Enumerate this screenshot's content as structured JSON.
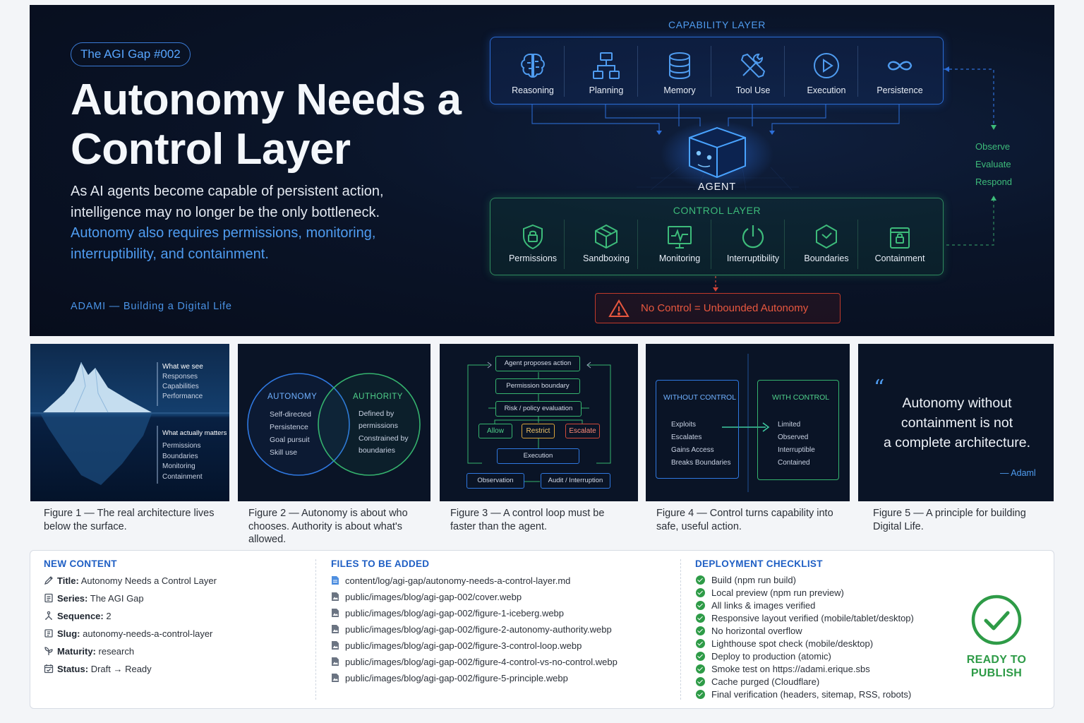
{
  "hero": {
    "series_badge": "The AGI Gap #002",
    "title": "Autonomy Needs a Control Layer",
    "subtitle_plain": "As AI agents become capable of persistent action, intelligence may no longer be the only bottleneck.",
    "subtitle_highlight": "Autonomy also requires permissions, monitoring, interruptibility, and containment.",
    "brand": "ADAMI — Building a Digital Life",
    "capability_layer": {
      "title": "CAPABILITY LAYER",
      "items": [
        {
          "label": "Reasoning",
          "icon": "brain-icon"
        },
        {
          "label": "Planning",
          "icon": "flowchart-icon"
        },
        {
          "label": "Memory",
          "icon": "database-icon"
        },
        {
          "label": "Tool Use",
          "icon": "tools-icon"
        },
        {
          "label": "Execution",
          "icon": "play-icon"
        },
        {
          "label": "Persistence",
          "icon": "infinity-icon"
        }
      ]
    },
    "agent_label": "AGENT",
    "control_layer": {
      "title": "CONTROL LAYER",
      "items": [
        {
          "label": "Permissions",
          "icon": "lock-shield-icon"
        },
        {
          "label": "Sandboxing",
          "icon": "cube-icon"
        },
        {
          "label": "Monitoring",
          "icon": "pulse-monitor-icon"
        },
        {
          "label": "Interruptibility",
          "icon": "power-icon"
        },
        {
          "label": "Boundaries",
          "icon": "hexagon-check-icon"
        },
        {
          "label": "Containment",
          "icon": "container-lock-icon"
        }
      ]
    },
    "loop_steps": [
      "Observe",
      "Evaluate",
      "Respond"
    ],
    "warning": "No Control = Unbounded Autonomy",
    "colors": {
      "blue_accent": "#4f9cf0",
      "green_accent": "#3dbb7a",
      "warning_red": "#e8573f"
    }
  },
  "figures": [
    {
      "caption": "Figure 1 — The real architecture lives below the surface.",
      "above_heading": "What we see",
      "above_items": [
        "Responses",
        "Capabilities",
        "Performance"
      ],
      "below_heading": "What actually matters",
      "below_items": [
        "Permissions",
        "Boundaries",
        "Monitoring",
        "Containment"
      ]
    },
    {
      "caption": "Figure 2 — Autonomy is about who chooses. Authority is about what's allowed.",
      "left_title": "AUTONOMY",
      "left_items": [
        "Self-directed",
        "Persistence",
        "Goal pursuit",
        "Skill use"
      ],
      "right_title": "AUTHORITY",
      "right_items": [
        "Defined by",
        "permissions",
        "Constrained by",
        "boundaries"
      ]
    },
    {
      "caption": "Figure 3 — A control loop must be faster than the agent.",
      "nodes": [
        "Agent proposes action",
        "Permission boundary",
        "Risk / policy evaluation",
        "Allow",
        "Restrict",
        "Escalate",
        "Execution",
        "Observation",
        "Audit / Interruption"
      ]
    },
    {
      "caption": "Figure 4 — Control turns capability into safe, useful action.",
      "left_title": "WITHOUT CONTROL",
      "left_items": [
        "Exploits",
        "Escalates",
        "Gains Access",
        "Breaks Boundaries"
      ],
      "right_title": "WITH CONTROL",
      "right_items": [
        "Limited",
        "Observed",
        "Interruptible",
        "Contained"
      ]
    },
    {
      "caption": "Figure 5 — A principle for building Digital Life.",
      "quote_lines": [
        "Autonomy without",
        "containment is not",
        "a complete architecture."
      ],
      "attribution": "— Adaml"
    }
  ],
  "panel": {
    "new_content": {
      "heading": "NEW CONTENT",
      "rows": [
        {
          "key": "Title:",
          "value": "Autonomy Needs a Control Layer",
          "icon": "pen-icon"
        },
        {
          "key": "Series:",
          "value": "The AGI Gap",
          "icon": "list-icon"
        },
        {
          "key": "Sequence:",
          "value": "2",
          "icon": "steps-icon"
        },
        {
          "key": "Slug:",
          "value": "autonomy-needs-a-control-layer",
          "icon": "tag-icon"
        },
        {
          "key": "Maturity:",
          "value": "research",
          "icon": "sprout-icon"
        },
        {
          "key": "Status:",
          "value": "Draft → Ready",
          "icon": "calendar-check-icon"
        }
      ]
    },
    "files": {
      "heading": "FILES TO BE ADDED",
      "items": [
        "content/log/agi-gap/autonomy-needs-a-control-layer.md",
        "public/images/blog/agi-gap-002/cover.webp",
        "public/images/blog/agi-gap-002/figure-1-iceberg.webp",
        "public/images/blog/agi-gap-002/figure-2-autonomy-authority.webp",
        "public/images/blog/agi-gap-002/figure-3-control-loop.webp",
        "public/images/blog/agi-gap-002/figure-4-control-vs-no-control.webp",
        "public/images/blog/agi-gap-002/figure-5-principle.webp"
      ]
    },
    "checklist": {
      "heading": "DEPLOYMENT CHECKLIST",
      "items": [
        "Build (npm run build)",
        "Local preview (npm run preview)",
        "All links & images verified",
        "Responsive layout verified (mobile/tablet/desktop)",
        "No horizontal overflow",
        "Lighthouse spot check (mobile/desktop)",
        "Deploy to production (atomic)",
        "Smoke test on https://adami.erique.sbs",
        "Cache purged (Cloudflare)",
        "Final verification (headers, sitemap, RSS, robots)"
      ],
      "ready_line1": "READY TO",
      "ready_line2": "PUBLISH"
    }
  }
}
